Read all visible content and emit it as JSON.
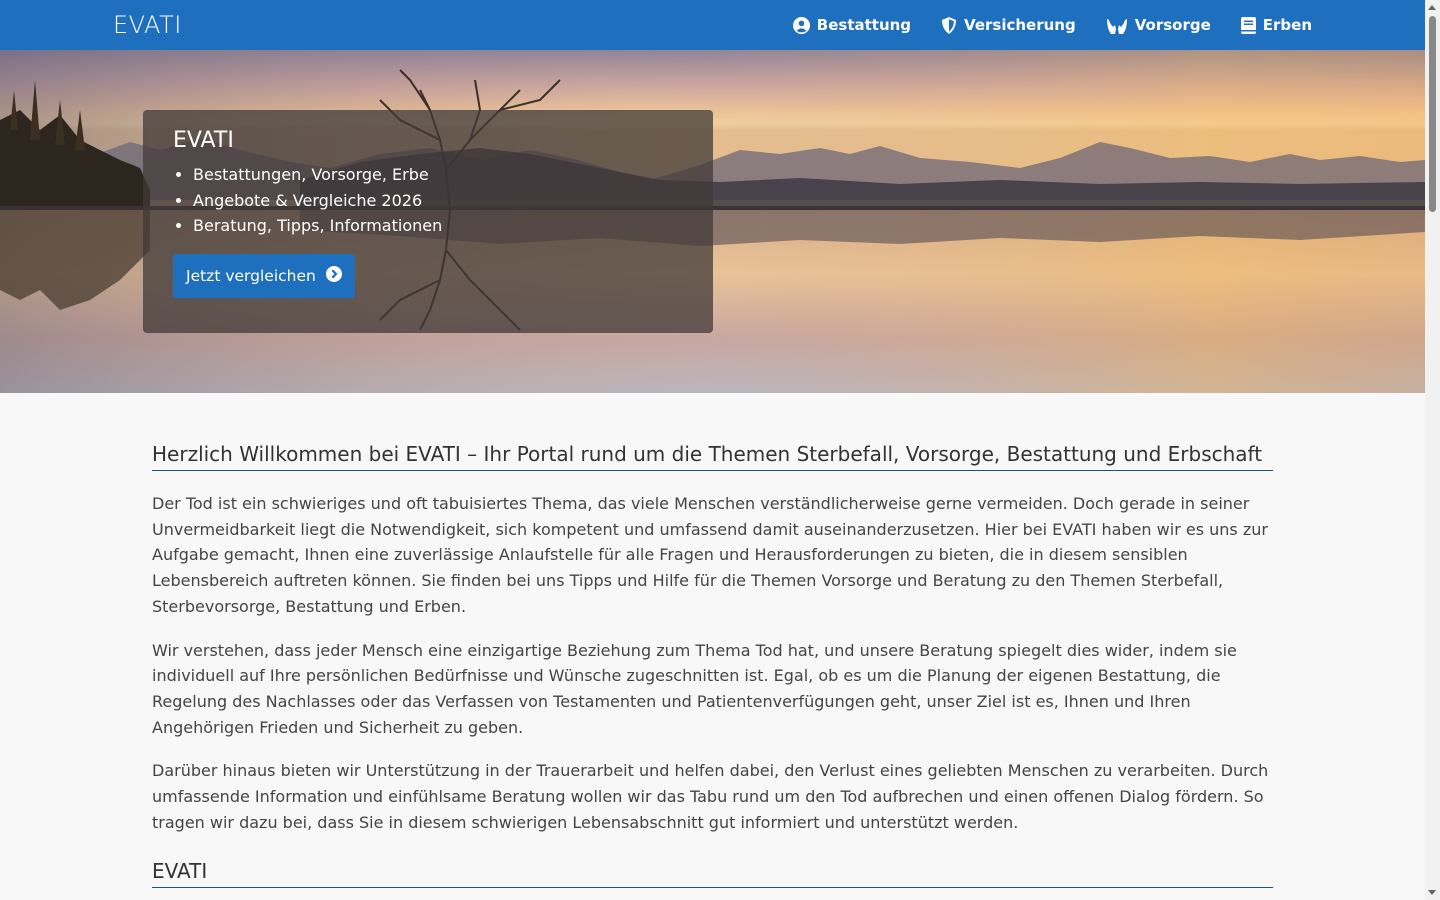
{
  "brand": "EVATI",
  "nav": [
    {
      "label": "Bestattung",
      "icon": "user-circle-icon"
    },
    {
      "label": "Versicherung",
      "icon": "shield-icon"
    },
    {
      "label": "Vorsorge",
      "icon": "hands-icon"
    },
    {
      "label": "Erben",
      "icon": "book-icon"
    }
  ],
  "hero": {
    "title": "EVATI",
    "bullets": [
      "Bestattungen, Vorsorge, Erbe",
      "Angebote & Vergleiche 2026",
      "Beratung, Tipps, Informationen"
    ],
    "cta_label": "Jetzt vergleichen",
    "cta_icon": "chevron-circle-right-icon"
  },
  "main": {
    "heading": "Herzlich Willkommen bei EVATI – Ihr Portal rund um die Themen Sterbefall, Vorsorge, Bestattung und Erbschaft",
    "paragraphs": [
      "Der Tod ist ein schwieriges und oft tabuisiertes Thema, das viele Menschen verständlicherweise gerne vermeiden. Doch gerade in seiner Unvermeidbarkeit liegt die Notwendigkeit, sich kompetent und umfassend damit auseinanderzusetzen. Hier bei EVATI haben wir es uns zur Aufgabe gemacht, Ihnen eine zuverlässige Anlaufstelle für alle Fragen und Herausforderungen zu bieten, die in diesem sensiblen Lebensbereich auftreten können. Sie finden bei uns Tipps und Hilfe für die Themen Vorsorge und Beratung zu den Themen Sterbefall, Sterbevorsorge, Bestattung und Erben.",
      "Wir verstehen, dass jeder Mensch eine einzigartige Beziehung zum Thema Tod hat, und unsere Beratung spiegelt dies wider, indem sie individuell auf Ihre persönlichen Bedürfnisse und Wünsche zugeschnitten ist. Egal, ob es um die Planung der eigenen Bestattung, die Regelung des Nachlasses oder das Verfassen von Testamenten und Patientenverfügungen geht, unser Ziel ist es, Ihnen und Ihren Angehörigen Frieden und Sicherheit zu geben.",
      "Darüber hinaus bieten wir Unterstützung in der Trauerarbeit und helfen dabei, den Verlust eines geliebten Menschen zu verarbeiten. Durch umfassende Information und einfühlsame Beratung wollen wir das Tabu rund um den Tod aufbrechen und einen offenen Dialog fördern. So tragen wir dazu bei, dass Sie in diesem schwierigen Lebensabschnitt gut informiert und unterstützt werden."
    ],
    "heading2": "EVATI"
  },
  "colors": {
    "primary": "#1f6fbf",
    "heading_rule": "#1c4f85",
    "background": "#f8f8f8"
  }
}
